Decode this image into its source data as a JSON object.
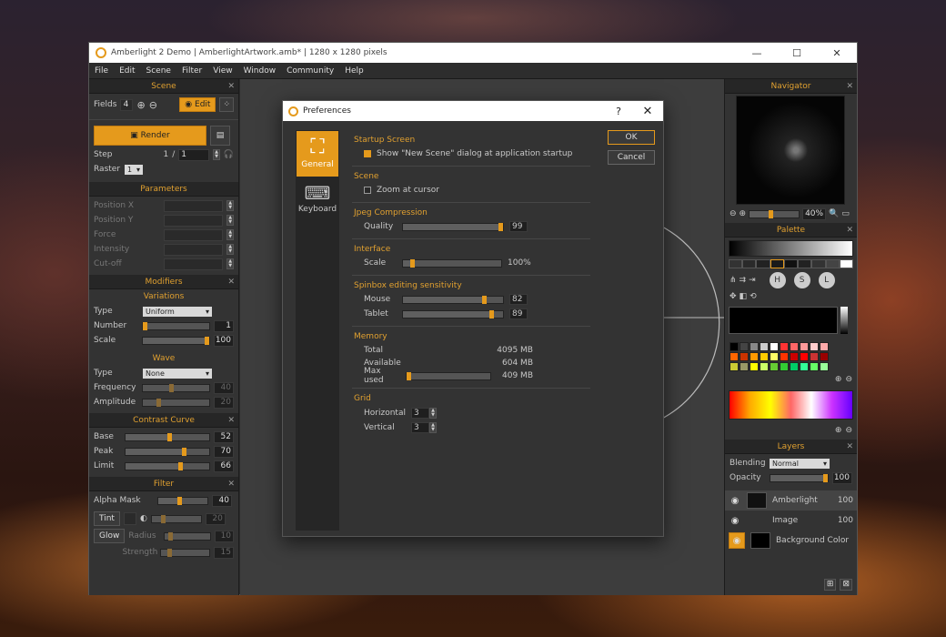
{
  "window": {
    "title": "Amberlight 2 Demo | AmberlightArtwork.amb* | 1280 x 1280 pixels",
    "controls": [
      "—",
      "☐",
      "✕"
    ]
  },
  "menu": [
    "File",
    "Edit",
    "Scene",
    "Filter",
    "View",
    "Window",
    "Community",
    "Help"
  ],
  "scene": {
    "title": "Scene",
    "fields_label": "Fields",
    "fields_value": "4",
    "edit_label": "Edit",
    "render_label": "Render",
    "step_label": "Step",
    "step_current": "1",
    "step_sep": "/",
    "step_total": "1",
    "raster_label": "Raster",
    "raster_value": "1"
  },
  "parameters": {
    "title": "Parameters",
    "items": [
      "Position X",
      "Position Y",
      "Force",
      "Intensity",
      "Cut-off"
    ]
  },
  "modifiers": {
    "title": "Modifiers",
    "variations": {
      "title": "Variations",
      "type_label": "Type",
      "type_value": "Uniform",
      "number_label": "Number",
      "number_value": "1",
      "scale_label": "Scale",
      "scale_value": "100"
    },
    "wave": {
      "title": "Wave",
      "type_label": "Type",
      "type_value": "None",
      "freq_label": "Frequency",
      "freq_value": "40",
      "amp_label": "Amplitude",
      "amp_value": "20"
    }
  },
  "contrast": {
    "title": "Contrast Curve",
    "base_label": "Base",
    "base_value": "52",
    "peak_label": "Peak",
    "peak_value": "70",
    "limit_label": "Limit",
    "limit_value": "66"
  },
  "filter": {
    "title": "Filter",
    "alpha_label": "Alpha Mask",
    "alpha_value": "40",
    "tint_label": "Tint",
    "tint_value": "20",
    "glow_label": "Glow",
    "radius_label": "Radius",
    "radius_value": "10",
    "strength_label": "Strength",
    "strength_value": "15"
  },
  "dialog": {
    "title": "Preferences",
    "help": "?",
    "close": "✕",
    "tabs": [
      {
        "label": "General"
      },
      {
        "label": "Keyboard"
      }
    ],
    "ok": "OK",
    "cancel": "Cancel",
    "startup": {
      "title": "Startup Screen",
      "option": "Show \"New Scene\" dialog at application startup",
      "checked": true
    },
    "scene": {
      "title": "Scene",
      "option": "Zoom at cursor",
      "checked": false
    },
    "jpeg": {
      "title": "Jpeg Compression",
      "quality_label": "Quality",
      "quality_value": "99",
      "quality_fraction": 0.99
    },
    "interface": {
      "title": "Interface",
      "scale_label": "Scale",
      "scale_value": "100%",
      "scale_fraction": 0.08
    },
    "spinbox": {
      "title": "Spinbox editing sensitivity",
      "mouse_label": "Mouse",
      "mouse_value": "82",
      "mouse_fraction": 0.82,
      "tablet_label": "Tablet",
      "tablet_value": "89",
      "tablet_fraction": 0.89
    },
    "memory": {
      "title": "Memory",
      "total_label": "Total",
      "total_value": "4095 MB",
      "available_label": "Available",
      "available_value": "604 MB",
      "max_label": "Max used",
      "max_value": "409 MB"
    },
    "grid": {
      "title": "Grid",
      "h_label": "Horizontal",
      "h_value": "3",
      "v_label": "Vertical",
      "v_value": "3"
    }
  },
  "navigator": {
    "title": "Navigator",
    "zoom": "40%"
  },
  "palette": {
    "title": "Palette",
    "buttons": [
      "H",
      "S",
      "L"
    ]
  },
  "layers": {
    "title": "Layers",
    "blending_label": "Blending",
    "blending_value": "Normal",
    "opacity_label": "Opacity",
    "opacity_value": "100",
    "items": [
      {
        "name": "Amberlight",
        "value": "100"
      },
      {
        "name": "Image",
        "value": "100"
      },
      {
        "name": "Background Color",
        "value": ""
      }
    ]
  },
  "colors": {
    "accent": "#e59a1c",
    "panel": "#333333",
    "header_text": "#e0a030"
  }
}
